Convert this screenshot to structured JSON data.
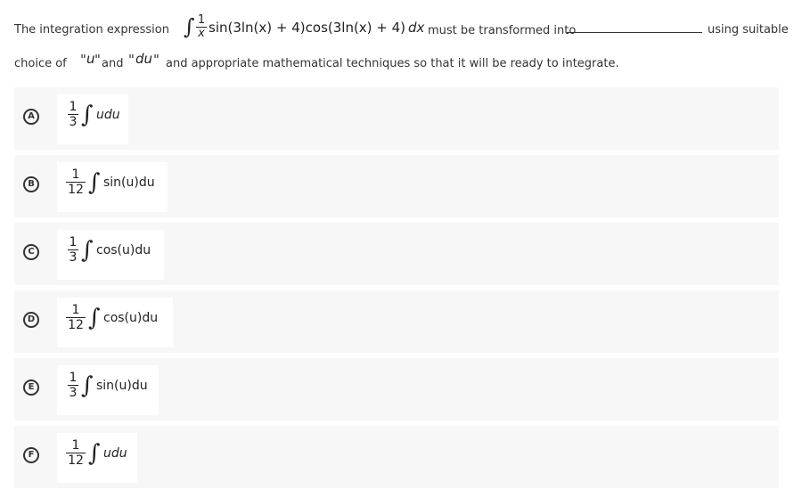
{
  "question": {
    "prefix": "The integration expression",
    "integral_sign": "∫",
    "integrand_fraction": {
      "numerator": "1",
      "denominator": "x"
    },
    "integrand": "sin(3ln(x) + 4)cos(3ln(x) + 4)",
    "differential": "dx",
    "middle": "must be transformed into",
    "suffix": "using suitable",
    "line2_start": "choice of",
    "u_var": "u",
    "and_word": "and",
    "du_var": "du",
    "line2_end": "and appropriate mathematical techniques so that it will be ready to integrate.",
    "quote": "\""
  },
  "options": [
    {
      "letter": "A",
      "numerator": "1",
      "denominator": "3",
      "integral": "∫",
      "expression": "udu"
    },
    {
      "letter": "B",
      "numerator": "1",
      "denominator": "12",
      "integral": "∫",
      "expression": "sin(u)du"
    },
    {
      "letter": "C",
      "numerator": "1",
      "denominator": "3",
      "integral": "∫",
      "expression": "cos(u)du"
    },
    {
      "letter": "D",
      "numerator": "1",
      "denominator": "12",
      "integral": "∫",
      "expression": "cos(u)du"
    },
    {
      "letter": "E",
      "numerator": "1",
      "denominator": "3",
      "integral": "∫",
      "expression": "sin(u)du"
    },
    {
      "letter": "F",
      "numerator": "1",
      "denominator": "12",
      "integral": "∫",
      "expression": "udu"
    }
  ]
}
